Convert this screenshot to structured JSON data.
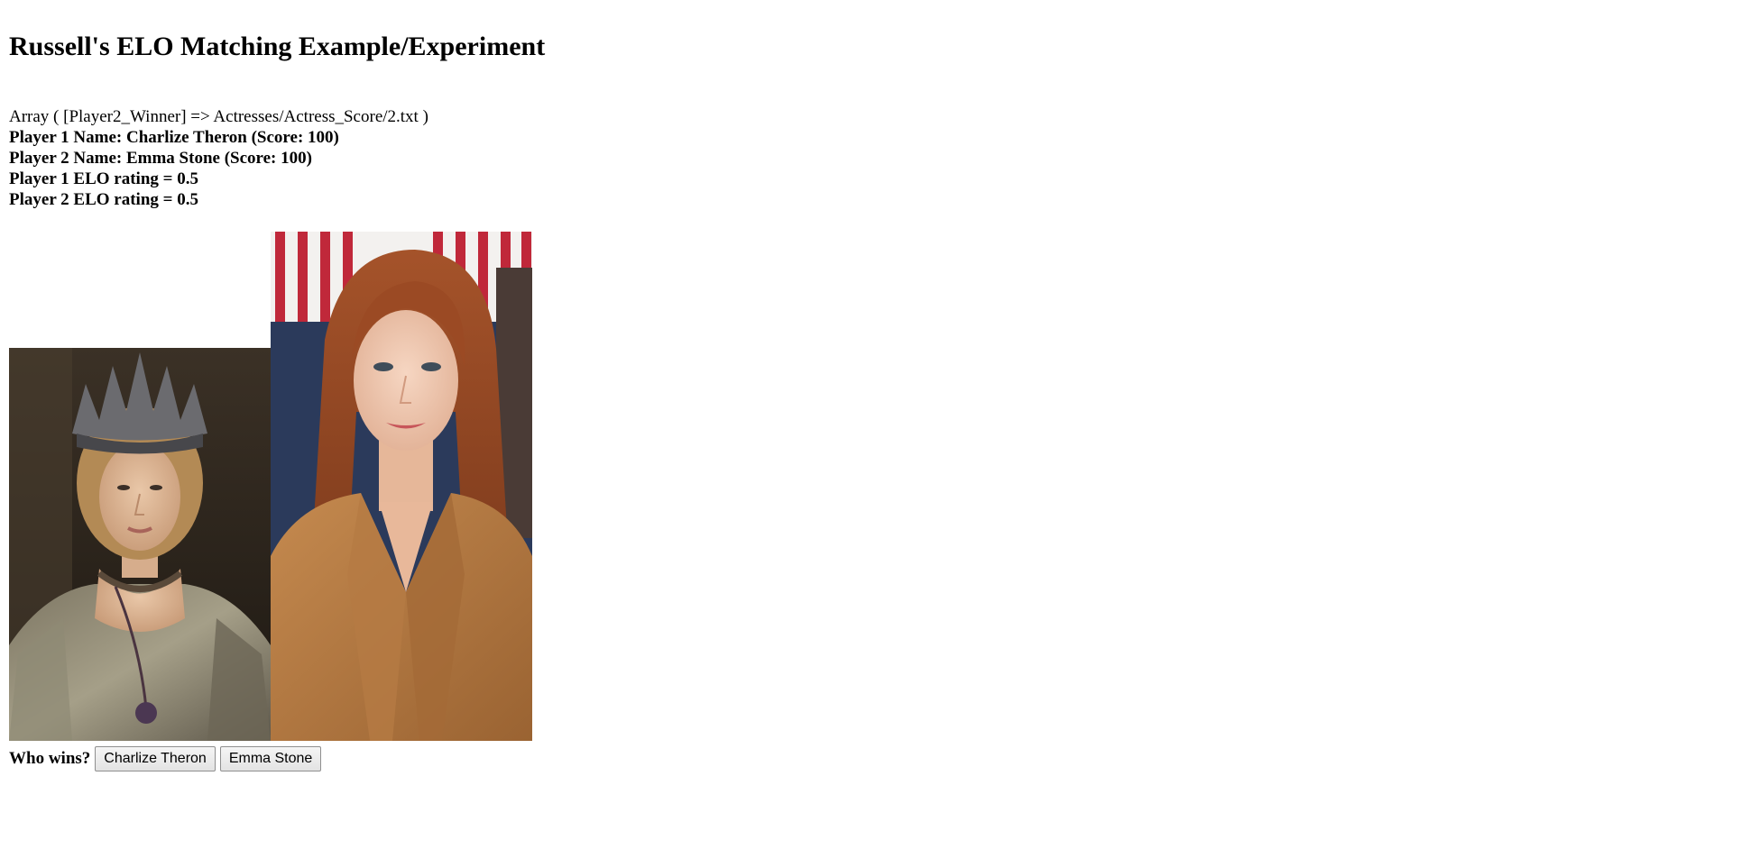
{
  "page": {
    "title": "Russell's ELO Matching Example/Experiment"
  },
  "debug": {
    "array_line": "Array ( [Player2_Winner] => Actresses/Actress_Score/2.txt )"
  },
  "players": [
    {
      "name_line": "Player 1 Name: Charlize Theron (Score: 100)",
      "elo_line": "Player 1 ELO rating = 0.5"
    },
    {
      "name_line": "Player 2 Name: Emma Stone (Score: 100)",
      "elo_line": "Player 2 ELO rating = 0.5"
    }
  ],
  "vote": {
    "prompt": "Who wins?",
    "buttons": [
      "Charlize Theron",
      "Emma Stone"
    ]
  }
}
